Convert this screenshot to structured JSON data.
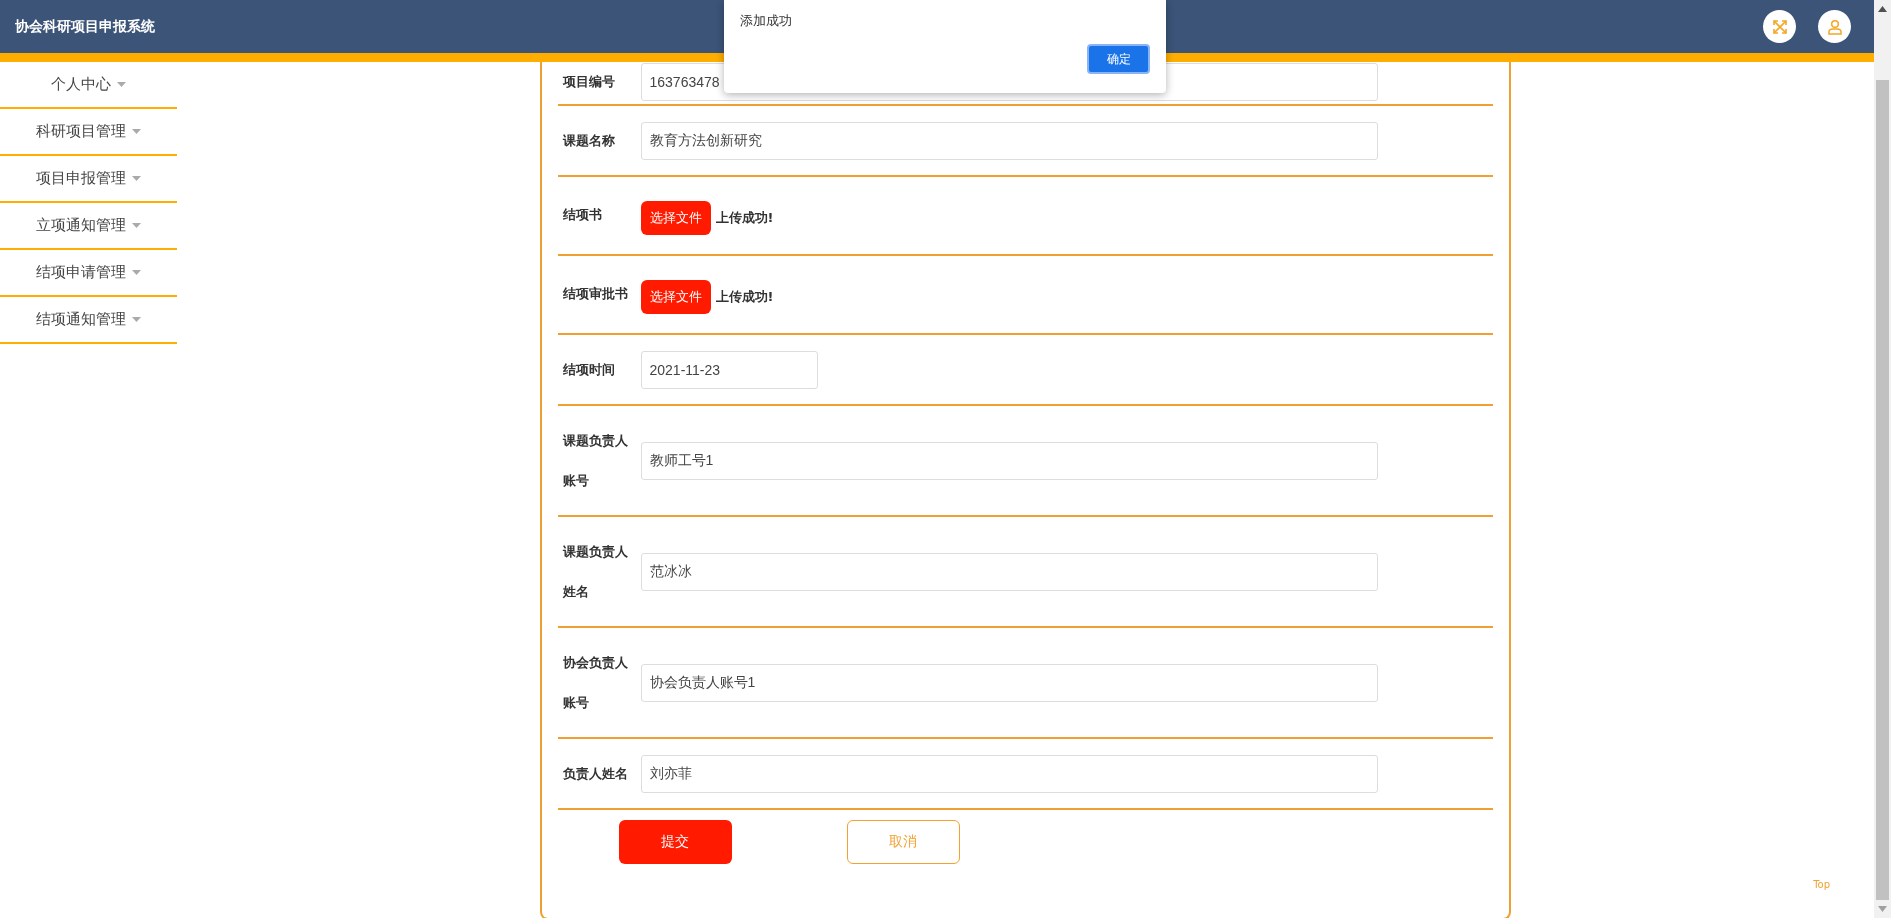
{
  "header": {
    "title": "协会科研项目申报系统"
  },
  "sidebar": {
    "items": [
      {
        "label": "个人中心"
      },
      {
        "label": "科研项目管理"
      },
      {
        "label": "项目申报管理"
      },
      {
        "label": "立项通知管理"
      },
      {
        "label": "结项申请管理"
      },
      {
        "label": "结项通知管理"
      }
    ]
  },
  "form": {
    "fields": [
      {
        "kind": "text",
        "label": "项目编号",
        "value": "163763478"
      },
      {
        "kind": "text",
        "label": "课题名称",
        "value": "教育方法创新研究"
      },
      {
        "kind": "file",
        "label": "结项书",
        "button": "选择文件",
        "status": "上传成功!"
      },
      {
        "kind": "file",
        "label": "结项审批书",
        "button": "选择文件",
        "status": "上传成功!"
      },
      {
        "kind": "date",
        "label": "结项时间",
        "value": "2021-11-23"
      },
      {
        "kind": "text",
        "label": "课题负责人账号",
        "value": "教师工号1"
      },
      {
        "kind": "text",
        "label": "课题负责人姓名",
        "value": "范冰冰"
      },
      {
        "kind": "text",
        "label": "协会负责人账号",
        "value": "协会负责人账号1"
      },
      {
        "kind": "text",
        "label": "负责人姓名",
        "value": "刘亦菲"
      }
    ],
    "buttons": [
      {
        "kind": "primary",
        "label": "提交"
      },
      {
        "kind": "secondary",
        "label": "取消"
      }
    ]
  },
  "dialog": {
    "message": "添加成功",
    "button": "确定"
  },
  "back_to_top": "Top"
}
